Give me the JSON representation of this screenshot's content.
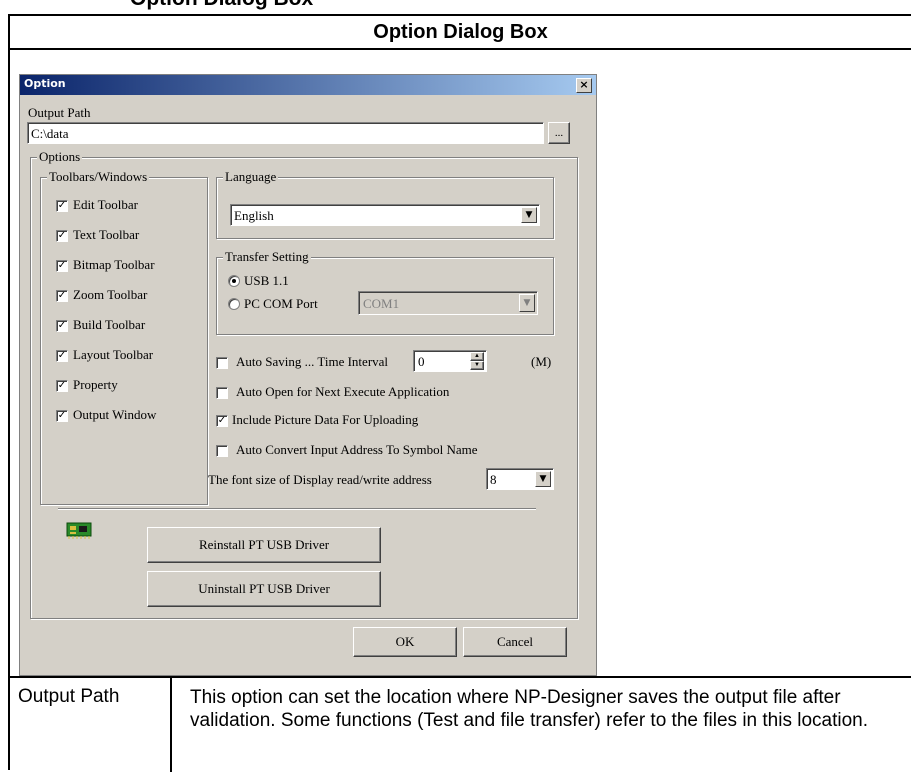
{
  "top_cut_text": "Option Dialog Box",
  "caption": "Option Dialog Box",
  "dialog": {
    "title": "Option",
    "close_glyph": "×",
    "output_path_label": "Output Path",
    "output_path_value": "C:\\data",
    "browse_label": "...",
    "options_group": "Options",
    "toolbars_group": "Toolbars/Windows",
    "toolbars": [
      {
        "label": "Edit Toolbar",
        "checked": true
      },
      {
        "label": "Text Toolbar",
        "checked": true
      },
      {
        "label": "Bitmap Toolbar",
        "checked": true
      },
      {
        "label": "Zoom Toolbar",
        "checked": true
      },
      {
        "label": "Build Toolbar",
        "checked": true
      },
      {
        "label": "Layout Toolbar",
        "checked": true
      },
      {
        "label": "Property",
        "checked": true
      },
      {
        "label": "Output Window",
        "checked": true
      }
    ],
    "language_group": "Language",
    "language_value": "English",
    "transfer_group": "Transfer Setting",
    "transfer_usb": "USB 1.1",
    "transfer_pc": "PC COM Port",
    "com_value": "COM1",
    "auto_saving": "Auto Saving ... Time Interval",
    "interval_value": "0",
    "interval_unit": "(M)",
    "auto_open": "Auto Open for Next Execute Application",
    "include_picture": "Include Picture Data For Uploading",
    "auto_convert": "Auto Convert Input Address To Symbol Name",
    "font_size_label": "The font size of Display read/write address",
    "font_size_value": "8",
    "reinstall_label": "Reinstall PT USB Driver",
    "uninstall_label": "Uninstall PT USB Driver",
    "ok_label": "OK",
    "cancel_label": "Cancel",
    "check_glyph": "✓",
    "arrow_glyph": "▼",
    "spin_up_glyph": "▲",
    "spin_down_glyph": "▼",
    "usb_icon": "usb-driver-icon"
  },
  "row": {
    "label": "Output Path",
    "description": "This option can set the location where NP-Designer saves the output file after validation. Some functions (Test and file transfer) refer to the files in this location."
  }
}
